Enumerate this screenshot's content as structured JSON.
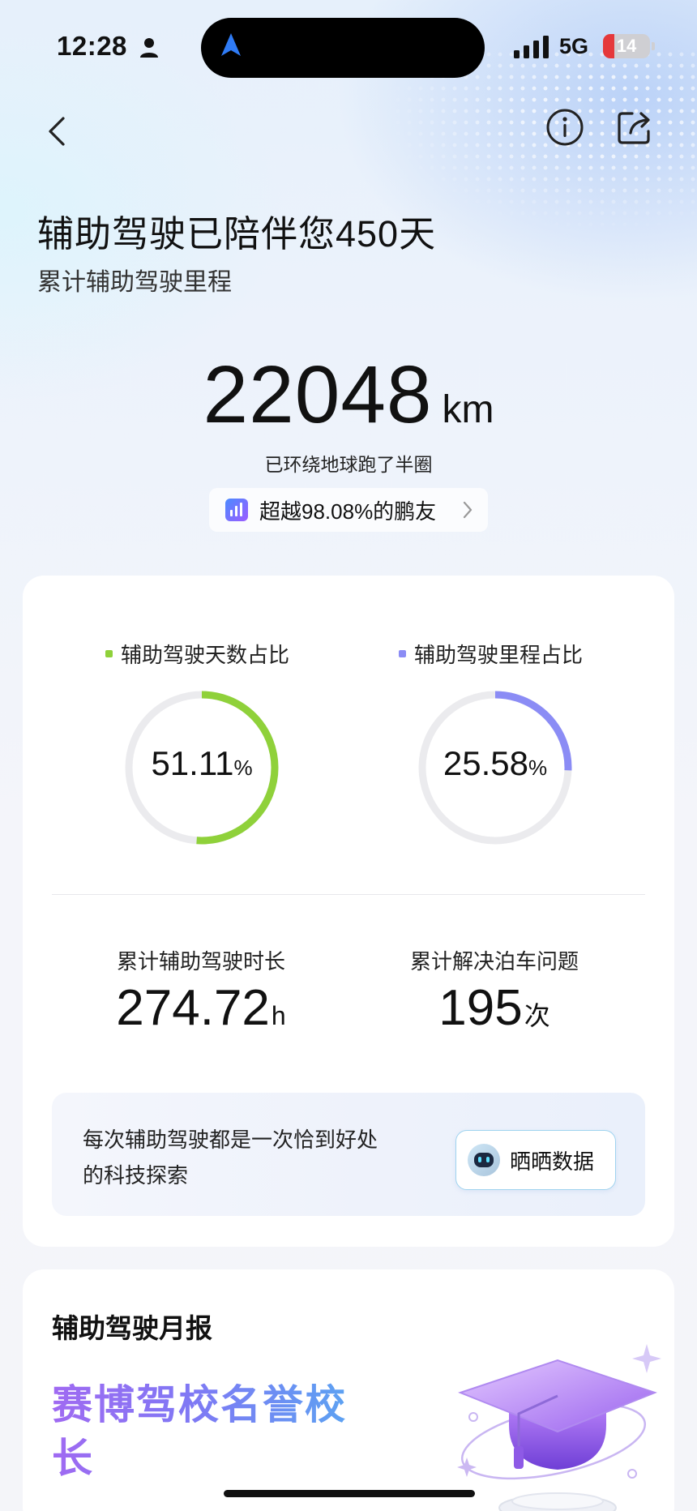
{
  "status_bar": {
    "time": "12:28",
    "network": "5G",
    "battery": "14"
  },
  "header": {
    "title": "辅助驾驶已陪伴您450天",
    "subtitle": "累计辅助驾驶里程"
  },
  "mileage": {
    "value": "22048",
    "unit": "km",
    "caption": "已环绕地球跑了半圈",
    "rank_text": "超越98.08%的鹏友"
  },
  "ratios": [
    {
      "label": "辅助驾驶天数占比",
      "value": "51.11",
      "unit": "%",
      "fraction": 0.5111,
      "color": "#8fd13a"
    },
    {
      "label": "辅助驾驶里程占比",
      "value": "25.58",
      "unit": "%",
      "fraction": 0.2558,
      "color": "#8b8cf5"
    }
  ],
  "stats": [
    {
      "label": "累计辅助驾驶时长",
      "value": "274.72",
      "unit": "h"
    },
    {
      "label": "累计解决泊车问题",
      "value": "195",
      "unit": "次"
    }
  ],
  "promo": {
    "text": "每次辅助驾驶都是一次恰到好处的科技探索",
    "button_label": "晒晒数据"
  },
  "monthly": {
    "title": "辅助驾驶月报",
    "honor": "赛博驾校名誉校长"
  },
  "colors": {
    "ring_track": "#ebebee",
    "accent_blue": "#2f7bf5"
  }
}
